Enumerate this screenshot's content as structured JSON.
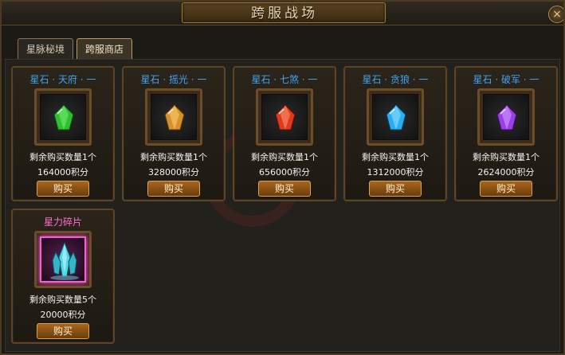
{
  "window": {
    "title": "跨服战场",
    "close_label": "×"
  },
  "tabs": [
    {
      "label": "星脉秘境",
      "active": false
    },
    {
      "label": "跨服商店",
      "active": true
    }
  ],
  "items": [
    {
      "name": "星石 · 天府 · 一",
      "gem_color": "#2fbf2f",
      "quantity": "剩余购买数量1个",
      "price": "164000积分",
      "buy_label": "购买"
    },
    {
      "name": "星石 · 摇光 · 一",
      "gem_color": "#d8902a",
      "quantity": "剩余购买数量1个",
      "price": "328000积分",
      "buy_label": "购买"
    },
    {
      "name": "星石 · 七煞 · 一",
      "gem_color": "#e03a1c",
      "quantity": "剩余购买数量1个",
      "price": "656000积分",
      "buy_label": "购买"
    },
    {
      "name": "星石 · 贪狼 · 一",
      "gem_color": "#29aef0",
      "quantity": "剩余购买数量1个",
      "price": "1312000积分",
      "buy_label": "购买"
    },
    {
      "name": "星石 · 破军 · 一",
      "gem_color": "#9a3ee8",
      "quantity": "剩余购买数量1个",
      "price": "2624000积分",
      "buy_label": "购买"
    },
    {
      "name": "星力碎片",
      "gem_color": "#4fd8e8",
      "quantity": "剩余购买数量5个",
      "price": "20000积分",
      "buy_label": "购买"
    }
  ]
}
